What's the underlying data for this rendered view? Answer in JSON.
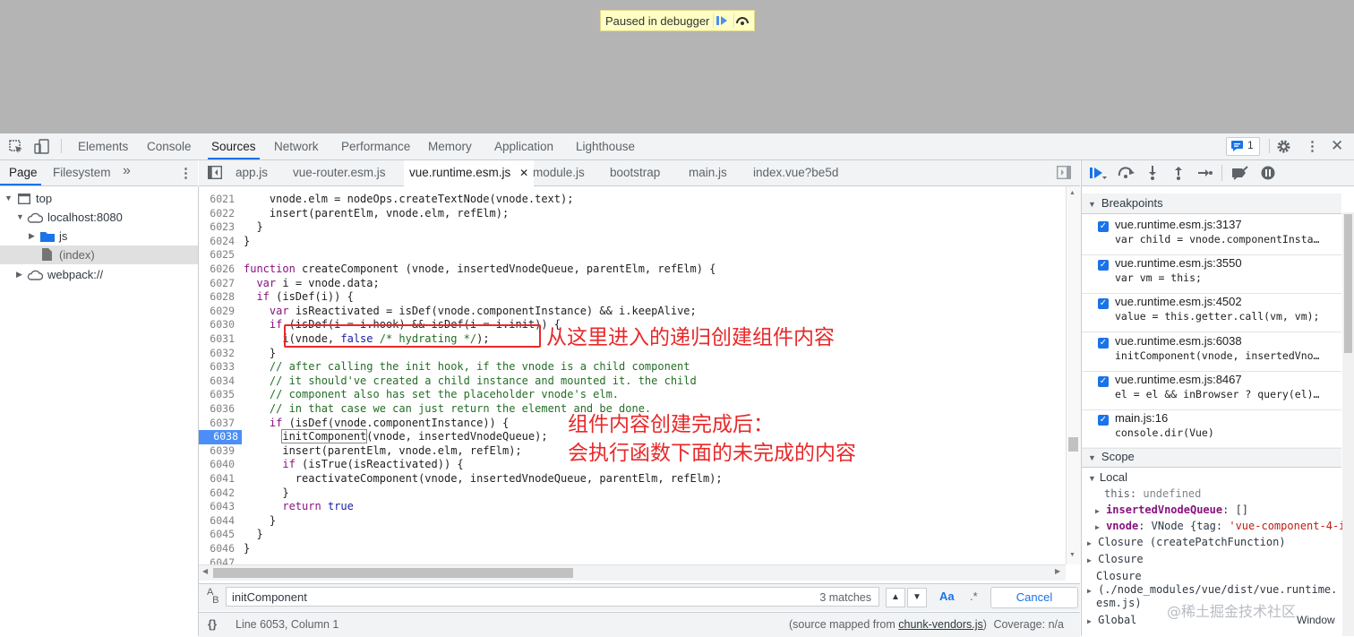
{
  "banner": {
    "text": "Paused in debugger"
  },
  "devtools_tabs": [
    "Elements",
    "Console",
    "Sources",
    "Network",
    "Performance",
    "Memory",
    "Application",
    "Lighthouse"
  ],
  "active_tab": "Sources",
  "issues_count": "1",
  "left_panel": {
    "tabs": [
      "Page",
      "Filesystem"
    ],
    "more": "»",
    "tree": [
      {
        "label": "top"
      },
      {
        "label": "localhost:8080"
      },
      {
        "label": "js"
      },
      {
        "label": "(index)"
      },
      {
        "label": "webpack://"
      }
    ]
  },
  "file_tabs": [
    "app.js",
    "vue-router.esm.js",
    "vue.runtime.esm.js",
    "module.js",
    "bootstrap",
    "main.js",
    "index.vue?be5d"
  ],
  "active_file": "vue.runtime.esm.js",
  "line_numbers": [
    "6021",
    "6022",
    "6023",
    "6024",
    "6025",
    "6026",
    "6027",
    "6028",
    "6029",
    "6030",
    "6031",
    "6032",
    "6033",
    "6034",
    "6035",
    "6036",
    "6037",
    "6038",
    "6039",
    "6040",
    "6041",
    "6042",
    "6043",
    "6044",
    "6045",
    "6046",
    "6047"
  ],
  "current_line": "6038",
  "code_lines": [
    "    vnode.elm = nodeOps.createTextNode(vnode.text);",
    "    insert(parentElm, vnode.elm, refElm);",
    "  }",
    "}",
    "",
    "function createComponent (vnode, insertedVnodeQueue, parentElm, refElm) {",
    "  var i = vnode.data;",
    "  if (isDef(i)) {",
    "    var isReactivated = isDef(vnode.componentInstance) && i.keepAlive;",
    "    if (isDef(i = i.hook) && isDef(i = i.init)) {",
    "      i(vnode, false /* hydrating */);",
    "    }",
    "    // after calling the init hook, if the vnode is a child component",
    "    // it should've created a child instance and mounted it. the child",
    "    // component also has set the placeholder vnode's elm.",
    "    // in that case we can just return the element and be done.",
    "    if (isDef(vnode.componentInstance)) {",
    "      initComponent(vnode, insertedVnodeQueue);",
    "      insert(parentElm, vnode.elm, refElm);",
    "      if (isTrue(isReactivated)) {",
    "        reactivateComponent(vnode, insertedVnodeQueue, parentElm, refElm);",
    "      }",
    "      return true",
    "    }",
    "  }",
    "}",
    ""
  ],
  "annotations": {
    "a1": "从这里进入的递归创建组件内容",
    "a2": "组件内容创建完成后：",
    "a3": "会执行函数下面的未完成的内容"
  },
  "search": {
    "value": "initComponent",
    "matches": "3 matches",
    "case_label": "Aa",
    "regex_label": ".*",
    "cancel": "Cancel"
  },
  "status": {
    "position": "Line 6053, Column 1",
    "mapped_prefix": "(source mapped from ",
    "mapped_file": "chunk-vendors.js",
    "mapped_suffix": ")",
    "coverage": "Coverage: n/a"
  },
  "breakpoints": {
    "title": "Breakpoints",
    "items": [
      {
        "file": "vue.runtime.esm.js:3137",
        "code": "var child = vnode.componentInsta…"
      },
      {
        "file": "vue.runtime.esm.js:3550",
        "code": "var vm = this;"
      },
      {
        "file": "vue.runtime.esm.js:4502",
        "code": "value = this.getter.call(vm, vm);"
      },
      {
        "file": "vue.runtime.esm.js:6038",
        "code": "initComponent(vnode, insertedVno…"
      },
      {
        "file": "vue.runtime.esm.js:8467",
        "code": "el = el && inBrowser ? query(el)…"
      },
      {
        "file": "main.js:16",
        "code": "console.dir(Vue)"
      }
    ]
  },
  "scope": {
    "title": "Scope",
    "local": "Local",
    "this_key": "this",
    "this_val": "undefined",
    "queue_key": "insertedVnodeQueue",
    "queue_val": "[]",
    "vnode_key": "vnode",
    "vnode_val": "VNode {tag: ",
    "vnode_tag": "'vue-component-4-i",
    "closure1": "Closure (createPatchFunction)",
    "closure2": "Closure",
    "closure3a": "Closure",
    "closure3b": "(./node_modules/vue/dist/vue.runtime.",
    "closure3c": "esm.js)",
    "global": "Global",
    "global_val": "Window"
  },
  "watermark": "@稀土掘金技术社区",
  "colors": {
    "accent": "#1a73e8",
    "annotation": "#e8292a",
    "banner": "#ffffc4"
  }
}
